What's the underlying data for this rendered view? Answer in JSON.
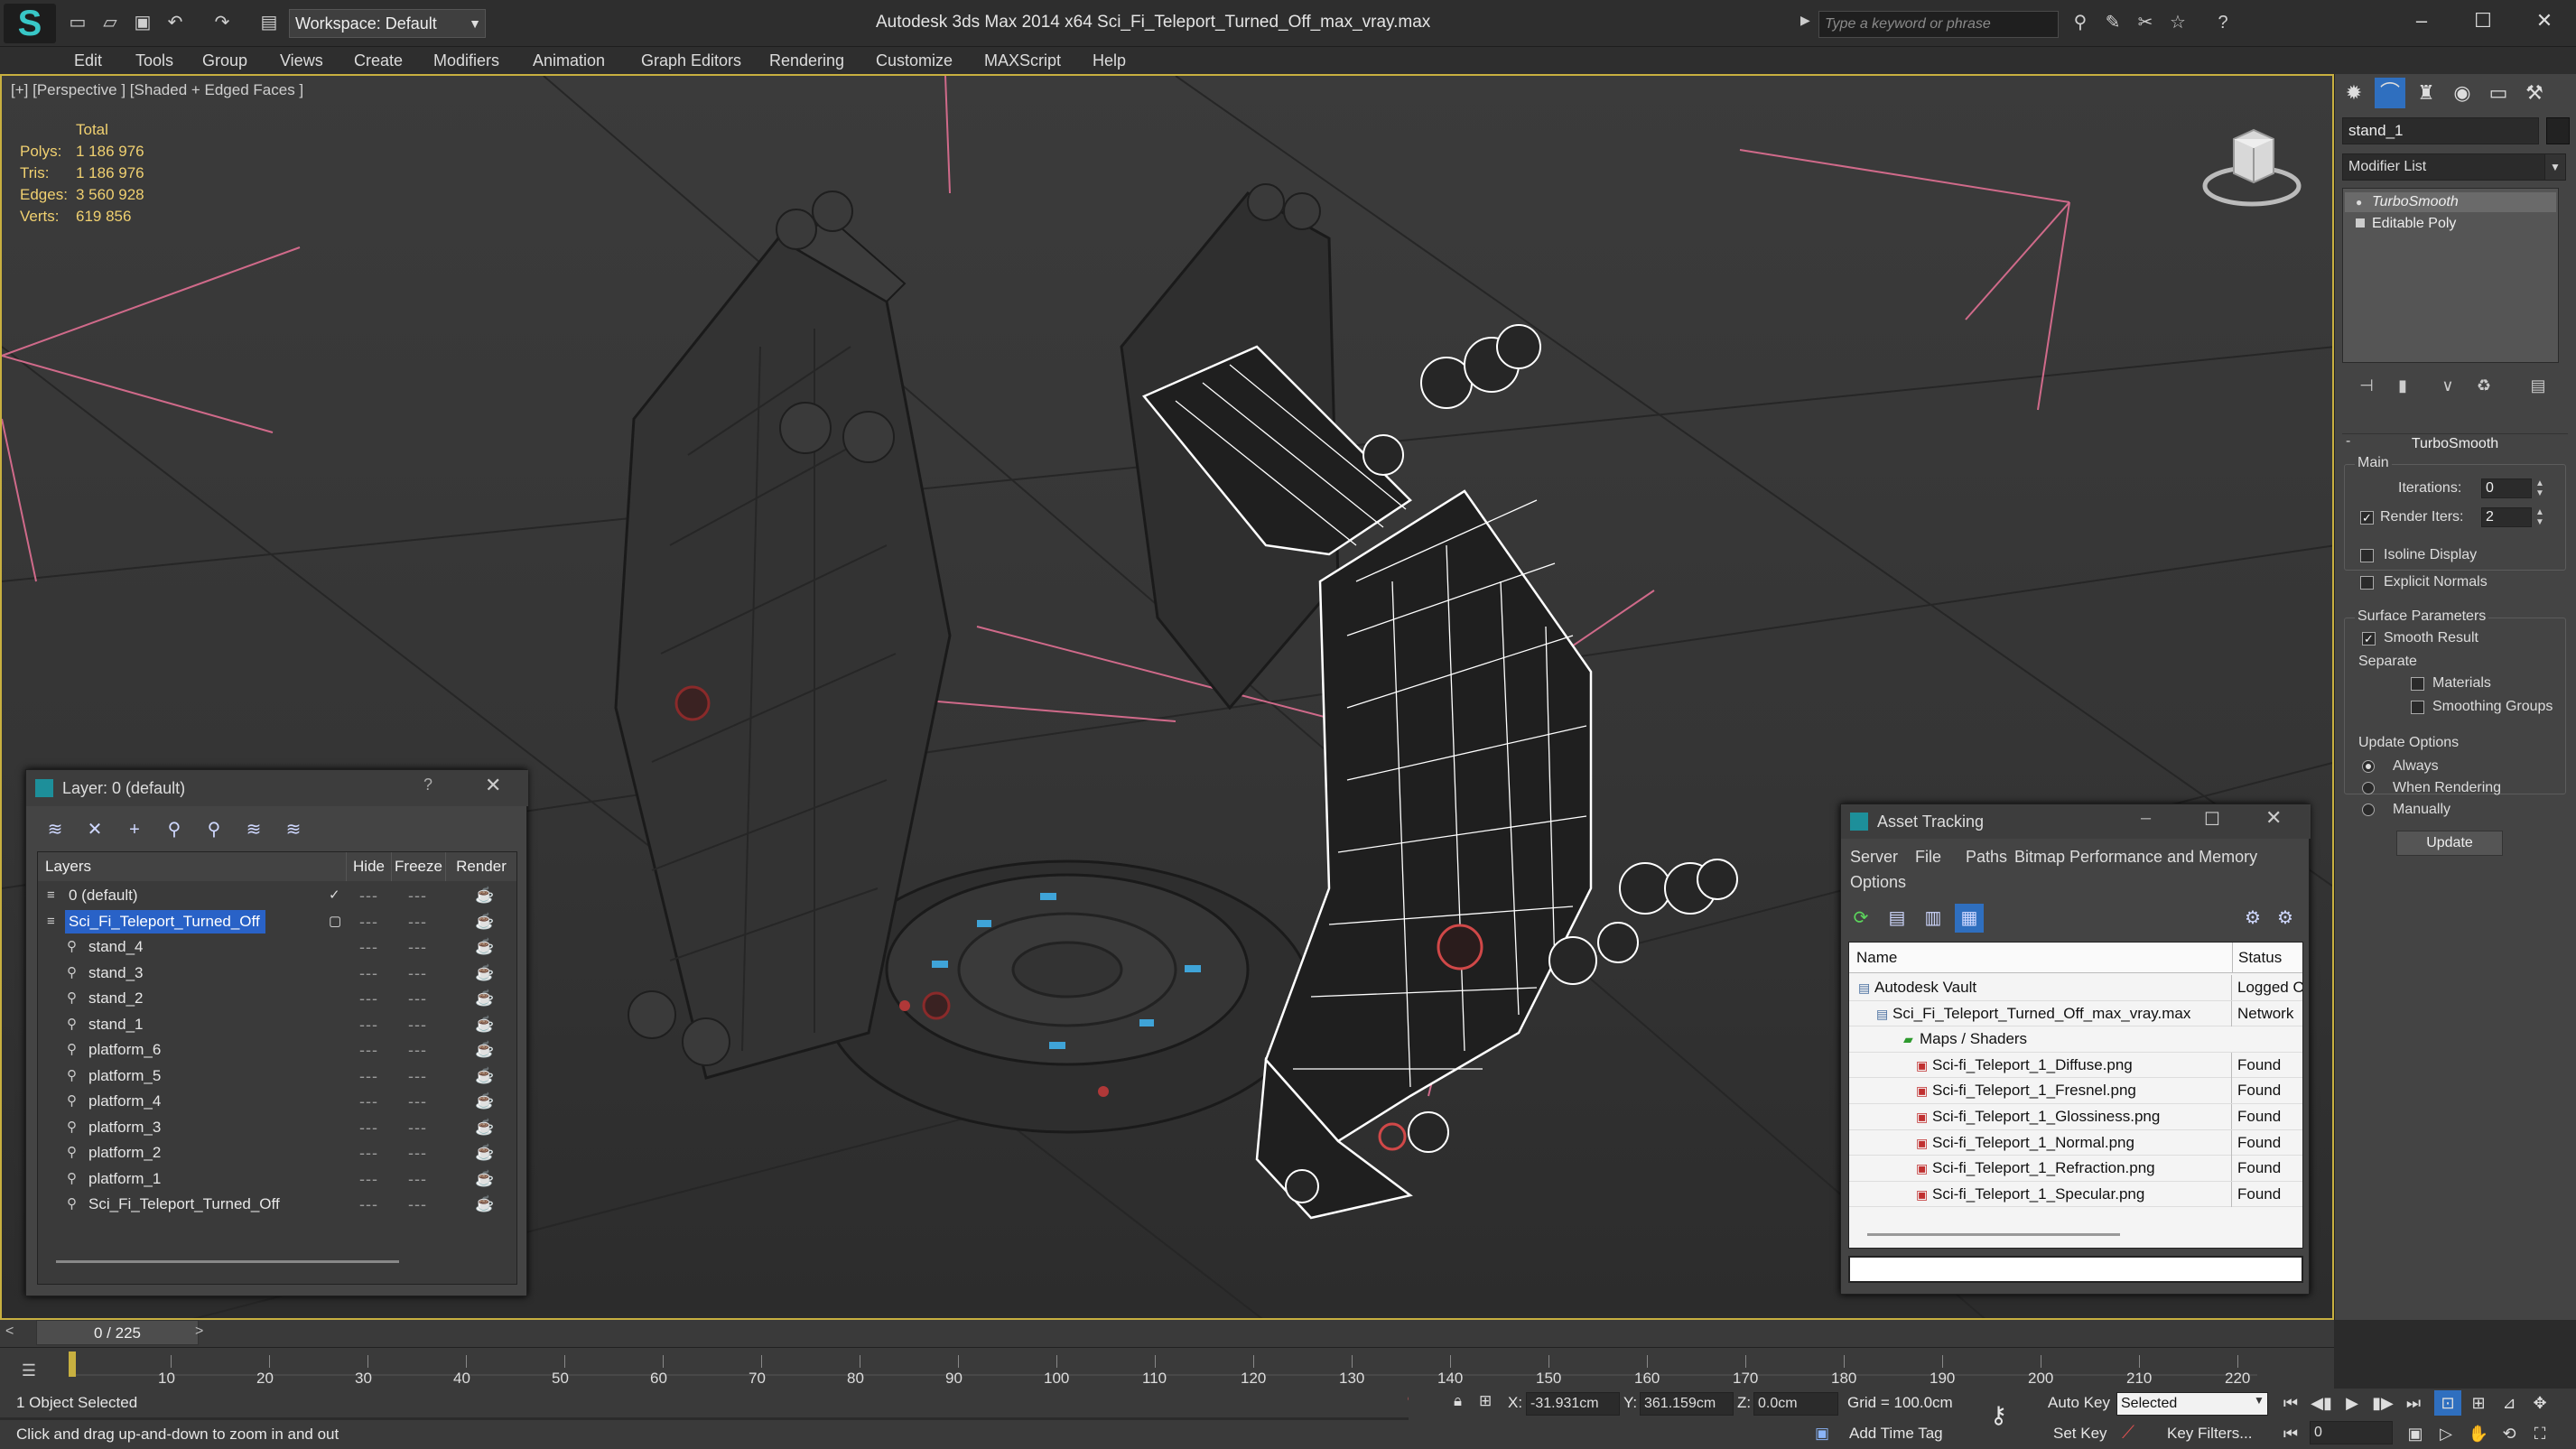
{
  "titlebar": {
    "workspace": "Workspace: Default",
    "app_title": "Autodesk 3ds Max  2014 x64     Sci_Fi_Teleport_Turned_Off_max_vray.max",
    "search_placeholder": "Type a keyword or phrase",
    "icons": [
      "new-file-icon",
      "open-file-icon",
      "save-icon",
      "undo-icon",
      "redo-icon",
      "project-folder-icon"
    ]
  },
  "menu": [
    "Edit",
    "Tools",
    "Group",
    "Views",
    "Create",
    "Modifiers",
    "Animation",
    "Graph Editors",
    "Rendering",
    "Customize",
    "MAXScript",
    "Help"
  ],
  "viewport": {
    "label": "[+] [Perspective ] [Shaded + Edged Faces ]",
    "stats": {
      "header": "Total",
      "rows": [
        {
          "label": "Polys:",
          "value": "1 186 976"
        },
        {
          "label": "Tris:",
          "value": "1 186 976"
        },
        {
          "label": "Edges:",
          "value": "3 560 928"
        },
        {
          "label": "Verts:",
          "value": "619 856"
        }
      ]
    }
  },
  "command_panel": {
    "object_name": "stand_1",
    "modifier_list": "Modifier List",
    "stack": [
      "TurboSmooth",
      "Editable Poly"
    ],
    "turbosmooth": {
      "title": "TurboSmooth",
      "main": "Main",
      "iterations_label": "Iterations:",
      "iterations_value": "0",
      "render_iters_label": "Render Iters:",
      "render_iters_value": "2",
      "isoline": "Isoline Display",
      "explicit_normals": "Explicit Normals",
      "surface_params": "Surface Parameters",
      "smooth_result": "Smooth Result",
      "separate": "Separate",
      "materials": "Materials",
      "smoothing_groups": "Smoothing Groups",
      "update_options": "Update Options",
      "always": "Always",
      "when_rendering": "When Rendering",
      "manually": "Manually",
      "update_button": "Update"
    }
  },
  "layer_dialog": {
    "title": "Layer: 0 (default)",
    "help": "?",
    "columns": [
      "Layers",
      "Hide",
      "Freeze",
      "Render"
    ],
    "rows": [
      {
        "name": "0 (default)",
        "indent": 0,
        "selected": false
      },
      {
        "name": "Sci_Fi_Teleport_Turned_Off",
        "indent": 0,
        "selected": true
      },
      {
        "name": "stand_4",
        "indent": 1,
        "selected": false
      },
      {
        "name": "stand_3",
        "indent": 1,
        "selected": false
      },
      {
        "name": "stand_2",
        "indent": 1,
        "selected": false
      },
      {
        "name": "stand_1",
        "indent": 1,
        "selected": false
      },
      {
        "name": "platform_6",
        "indent": 1,
        "selected": false
      },
      {
        "name": "platform_5",
        "indent": 1,
        "selected": false
      },
      {
        "name": "platform_4",
        "indent": 1,
        "selected": false
      },
      {
        "name": "platform_3",
        "indent": 1,
        "selected": false
      },
      {
        "name": "platform_2",
        "indent": 1,
        "selected": false
      },
      {
        "name": "platform_1",
        "indent": 1,
        "selected": false
      },
      {
        "name": "Sci_Fi_Teleport_Turned_Off",
        "indent": 1,
        "selected": false
      }
    ]
  },
  "asset_tracking": {
    "title": "Asset Tracking",
    "menu": [
      "Server",
      "File",
      "Paths",
      "Bitmap Performance and Memory",
      "Options"
    ],
    "columns": [
      "Name",
      "Status"
    ],
    "rows": [
      {
        "name": "Autodesk Vault",
        "status": "Logged O",
        "indent": 0
      },
      {
        "name": "Sci_Fi_Teleport_Turned_Off_max_vray.max",
        "status": "Network",
        "indent": 1
      },
      {
        "name": "Maps / Shaders",
        "status": "",
        "indent": 2
      },
      {
        "name": "Sci-fi_Teleport_1_Diffuse.png",
        "status": "Found",
        "indent": 3
      },
      {
        "name": "Sci-fi_Teleport_1_Fresnel.png",
        "status": "Found",
        "indent": 3
      },
      {
        "name": "Sci-fi_Teleport_1_Glossiness.png",
        "status": "Found",
        "indent": 3
      },
      {
        "name": "Sci-fi_Teleport_1_Normal.png",
        "status": "Found",
        "indent": 3
      },
      {
        "name": "Sci-fi_Teleport_1_Refraction.png",
        "status": "Found",
        "indent": 3
      },
      {
        "name": "Sci-fi_Teleport_1_Specular.png",
        "status": "Found",
        "indent": 3
      }
    ]
  },
  "timeline": {
    "slider": "0 / 225",
    "ticks": [
      "10",
      "20",
      "30",
      "40",
      "50",
      "60",
      "70",
      "80",
      "90",
      "100",
      "110",
      "120",
      "130",
      "140",
      "150",
      "160",
      "170",
      "180",
      "190",
      "200",
      "210",
      "220"
    ]
  },
  "status": {
    "selection": "1 Object Selected",
    "prompt": "Click and drag up-and-down to zoom in and out",
    "x_label": "X:",
    "x_value": "-31.931cm",
    "y_label": "Y:",
    "y_value": "361.159cm",
    "z_label": "Z:",
    "z_value": "0.0cm",
    "grid": "Grid = 100.0cm",
    "add_time_tag": "Add Time Tag",
    "auto_key": "Auto Key",
    "set_key": "Set Key",
    "selected": "Selected",
    "key_filters": "Key Filters...",
    "frame": "0"
  },
  "colors": {
    "accent": "#2962c7",
    "viewport_border": "#c8b040",
    "stats_text": "#f0d070",
    "light_lines": "#d06a8a"
  }
}
